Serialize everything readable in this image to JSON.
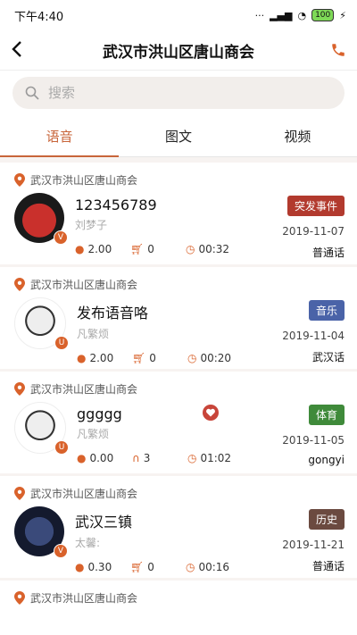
{
  "status_bar": {
    "time": "下午4:40",
    "battery": "100"
  },
  "nav": {
    "title": "武汉市洪山区唐山商会"
  },
  "search": {
    "placeholder": "搜索"
  },
  "tabs": [
    {
      "label": "语音"
    },
    {
      "label": "图文"
    },
    {
      "label": "视频"
    }
  ],
  "items": [
    {
      "location": "武汉市洪山区唐山商会",
      "title": "123456789",
      "author": "刘梦子",
      "price": "2.00",
      "count": "0",
      "duration": "00:32",
      "tag": "突发事件",
      "tag_color": "#b23a2e",
      "date": "2019-11-07",
      "dialect": "普通话",
      "badge": "V"
    },
    {
      "location": "武汉市洪山区唐山商会",
      "title": "发布语音咯",
      "author": "凡繁烦",
      "price": "2.00",
      "count": "0",
      "duration": "00:20",
      "tag": "音乐",
      "tag_color": "#4a63a8",
      "date": "2019-11-04",
      "dialect": "武汉话",
      "badge": "U"
    },
    {
      "location": "武汉市洪山区唐山商会",
      "title": "ggggg",
      "author": "凡繁烦",
      "price": "0.00",
      "count": "3",
      "duration": "01:02",
      "tag": "体育",
      "tag_color": "#3f8a3a",
      "date": "2019-11-05",
      "dialect": "gongyi",
      "badge": "U"
    },
    {
      "location": "武汉市洪山区唐山商会",
      "title": "武汉三镇",
      "author": "太馨:",
      "price": "0.30",
      "count": "0",
      "duration": "00:16",
      "tag": "历史",
      "tag_color": "#6b4a40",
      "date": "2019-11-21",
      "dialect": "普通话",
      "badge": "V"
    },
    {
      "location": "武汉市洪山区唐山商会"
    }
  ],
  "colors": {
    "accent": "#c8653a",
    "badge": "#d9622b"
  }
}
